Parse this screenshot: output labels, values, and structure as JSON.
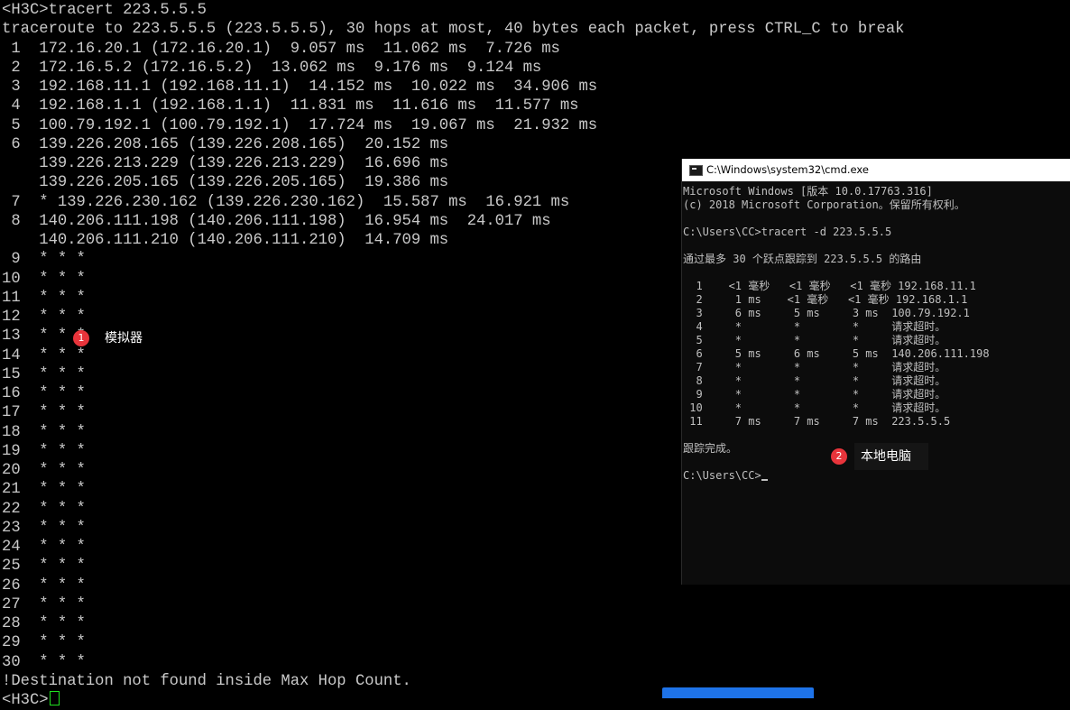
{
  "terminal": {
    "lines": [
      "<H3C>tracert 223.5.5.5",
      "traceroute to 223.5.5.5 (223.5.5.5), 30 hops at most, 40 bytes each packet, press CTRL_C to break",
      " 1  172.16.20.1 (172.16.20.1)  9.057 ms  11.062 ms  7.726 ms",
      " 2  172.16.5.2 (172.16.5.2)  13.062 ms  9.176 ms  9.124 ms",
      " 3  192.168.11.1 (192.168.11.1)  14.152 ms  10.022 ms  34.906 ms",
      " 4  192.168.1.1 (192.168.1.1)  11.831 ms  11.616 ms  11.577 ms",
      " 5  100.79.192.1 (100.79.192.1)  17.724 ms  19.067 ms  21.932 ms",
      " 6  139.226.208.165 (139.226.208.165)  20.152 ms",
      "    139.226.213.229 (139.226.213.229)  16.696 ms",
      "    139.226.205.165 (139.226.205.165)  19.386 ms",
      " 7  * 139.226.230.162 (139.226.230.162)  15.587 ms  16.921 ms",
      " 8  140.206.111.198 (140.206.111.198)  16.954 ms  24.017 ms",
      "    140.206.111.210 (140.206.111.210)  14.709 ms",
      " 9  * * *",
      "10  * * *",
      "11  * * *",
      "12  * * *",
      "13  * * *",
      "14  * * *",
      "15  * * *",
      "16  * * *",
      "17  * * *",
      "18  * * *",
      "19  * * *",
      "20  * * *",
      "21  * * *",
      "22  * * *",
      "23  * * *",
      "24  * * *",
      "25  * * *",
      "26  * * *",
      "27  * * *",
      "28  * * *",
      "29  * * *",
      "30  * * *",
      "!Destination not found inside Max Hop Count.",
      "<H3C>"
    ]
  },
  "annotations": [
    {
      "number": "1",
      "label": "模拟器"
    },
    {
      "number": "2",
      "label": "本地电脑"
    }
  ],
  "cmd": {
    "title": "C:\\Windows\\system32\\cmd.exe",
    "lines": [
      "Microsoft Windows [版本 10.0.17763.316]",
      "(c) 2018 Microsoft Corporation。保留所有权利。",
      "",
      "C:\\Users\\CC>tracert -d 223.5.5.5",
      "",
      "通过最多 30 个跃点跟踪到 223.5.5.5 的路由",
      "",
      "  1    <1 毫秒   <1 毫秒   <1 毫秒 192.168.11.1",
      "  2     1 ms    <1 毫秒   <1 毫秒 192.168.1.1",
      "  3     6 ms     5 ms     3 ms  100.79.192.1",
      "  4     *        *        *     请求超时。",
      "  5     *        *        *     请求超时。",
      "  6     5 ms     6 ms     5 ms  140.206.111.198",
      "  7     *        *        *     请求超时。",
      "  8     *        *        *     请求超时。",
      "  9     *        *        *     请求超时。",
      " 10     *        *        *     请求超时。",
      " 11     7 ms     7 ms     7 ms  223.5.5.5",
      "",
      "跟踪完成。",
      "",
      "C:\\Users\\CC>"
    ]
  },
  "colors": {
    "terminal_bg": "#000000",
    "terminal_text": "#c9c9c9",
    "cursor_green": "#20e020",
    "badge_red": "#e8343b",
    "taskbar_blue": "#1e73e8"
  }
}
